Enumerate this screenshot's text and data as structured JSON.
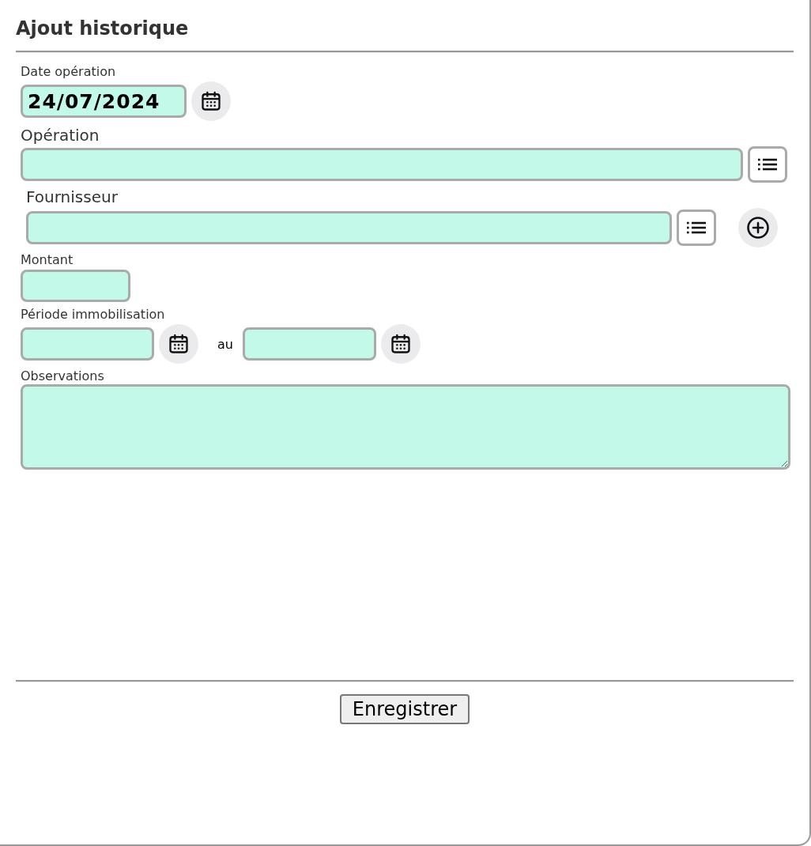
{
  "title": "Ajout historique",
  "fields": [
    {
      "kind": "date",
      "label": "Date opération",
      "value": "24/07/2024"
    },
    {
      "kind": "list",
      "label": "Opération"
    },
    {
      "kind": "list_add",
      "label": "Fournisseur"
    },
    {
      "kind": "text",
      "label": "Montant"
    },
    {
      "kind": "range",
      "label": "Période immobilisation",
      "separator": "au"
    },
    {
      "kind": "textarea",
      "label": "Observations"
    }
  ],
  "submit": "Enregistrer"
}
